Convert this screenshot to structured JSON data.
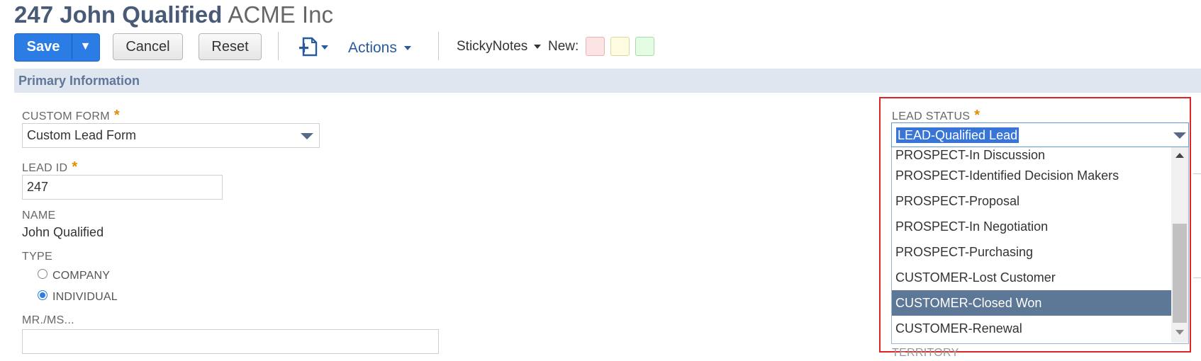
{
  "header": {
    "record_title": "247 John Qualified",
    "company": "ACME Inc"
  },
  "toolbar": {
    "save_label": "Save",
    "save_dropdown_glyph": "▼",
    "cancel_label": "Cancel",
    "reset_label": "Reset",
    "add_icon": "new-document-plus-icon",
    "actions_label": "Actions",
    "stickynotes_label": "StickyNotes",
    "new_label": "New:",
    "note_colors": [
      "#fde4e4",
      "#fdfbe0",
      "#e4fbe4"
    ]
  },
  "section": {
    "title": "Primary Information"
  },
  "fields": {
    "custom_form": {
      "label": "CUSTOM FORM",
      "required_mark": "*",
      "value": "Custom Lead Form"
    },
    "lead_id": {
      "label": "LEAD ID",
      "required_mark": "*",
      "value": "247"
    },
    "name": {
      "label": "NAME",
      "value": "John Qualified"
    },
    "type": {
      "label": "TYPE",
      "options": [
        {
          "label": "COMPANY",
          "selected": false
        },
        {
          "label": "INDIVIDUAL",
          "selected": true
        }
      ]
    },
    "salutation": {
      "label": "MR./MS...",
      "value": ""
    },
    "lead_status": {
      "label": "LEAD STATUS",
      "required_mark": "*",
      "value": "LEAD-Qualified Lead",
      "options": [
        "PROSPECT-In Discussion",
        "PROSPECT-Identified Decision Makers",
        "PROSPECT-Proposal",
        "PROSPECT-In Negotiation",
        "PROSPECT-Purchasing",
        "CUSTOMER-Lost Customer",
        "CUSTOMER-Closed Won",
        "CUSTOMER-Renewal"
      ],
      "highlighted_option": "CUSTOMER-Closed Won"
    },
    "territory": {
      "label": "TERRITORY"
    }
  },
  "colors": {
    "primary_button": "#2b7ce4",
    "title": "#485a75",
    "section_bg": "#e0e6ef",
    "required": "#e48b00",
    "highlight_box": "#e02424",
    "selected_option": "#5d7796"
  }
}
